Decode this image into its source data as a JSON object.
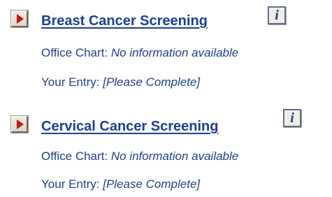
{
  "sections": [
    {
      "title": "Breast Cancer Screening",
      "info_label": "i",
      "office_chart_label": "Office Chart:",
      "office_chart_value": "No information available",
      "your_entry_label": "Your Entry:",
      "your_entry_value": "[Please Complete]"
    },
    {
      "title": "Cervical Cancer Screening",
      "info_label": "i",
      "office_chart_label": "Office Chart:",
      "office_chart_value": "No information available",
      "your_entry_label": "Your Entry:",
      "your_entry_value": "[Please Complete]"
    }
  ],
  "colors": {
    "link": "#1d3d96",
    "text": "#1f3f86",
    "arrow": "#c01818"
  },
  "icons": {
    "expand": "expand-arrow-icon",
    "info": "info-icon"
  }
}
